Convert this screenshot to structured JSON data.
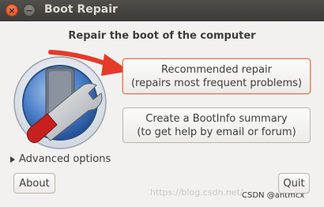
{
  "window": {
    "title": "Boot Repair",
    "close_glyph": "×",
    "minimize_glyph": "−"
  },
  "main": {
    "heading": "Repair the boot of the computer",
    "logo_icon": "boot-repair-logo-icon",
    "recommended": {
      "line1": "Recommended repair",
      "line2": "(repairs most frequent problems)"
    },
    "bootinfo": {
      "line1": "Create a BootInfo summary",
      "line2": "(to get help by email or forum)"
    },
    "advanced_label": "Advanced options"
  },
  "footer": {
    "about_label": "About",
    "quit_label": "Quit"
  },
  "watermark": {
    "url": "https://blog.csdn.net/",
    "author": "CSDN @antmcx"
  },
  "colors": {
    "titlebar": "#3c3b37",
    "close_button": "#df4b16",
    "highlight_border": "#e57b52",
    "annotation_arrow": "#e53a2a"
  }
}
